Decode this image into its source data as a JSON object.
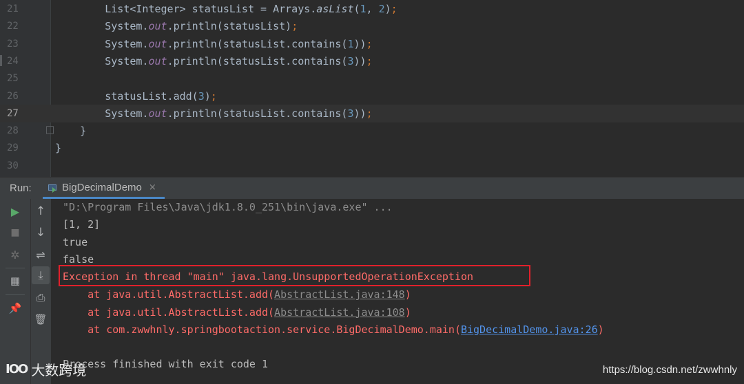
{
  "editor": {
    "lines": [
      {
        "num": "21",
        "indent": "        ",
        "tokens": [
          {
            "t": "List<Integer> statusList = Arrays."
          },
          {
            "t": "asList",
            "c": "k-m"
          },
          {
            "t": "("
          },
          {
            "t": "1",
            "c": "k-n"
          },
          {
            "t": ", "
          },
          {
            "t": "2",
            "c": "k-n"
          },
          {
            "t": ")"
          },
          {
            "t": ";",
            "c": "k-o"
          }
        ]
      },
      {
        "num": "22",
        "indent": "        ",
        "tokens": [
          {
            "t": "System."
          },
          {
            "t": "out",
            "c": "k-i"
          },
          {
            "t": ".println(statusList)"
          },
          {
            "t": ";",
            "c": "k-o"
          }
        ]
      },
      {
        "num": "23",
        "indent": "        ",
        "tokens": [
          {
            "t": "System."
          },
          {
            "t": "out",
            "c": "k-i"
          },
          {
            "t": ".println(statusList.contains("
          },
          {
            "t": "1",
            "c": "k-n"
          },
          {
            "t": "))"
          },
          {
            "t": ";",
            "c": "k-o"
          }
        ]
      },
      {
        "num": "24",
        "indent": "        ",
        "tokens": [
          {
            "t": "System."
          },
          {
            "t": "out",
            "c": "k-i"
          },
          {
            "t": ".println(statusList.contains("
          },
          {
            "t": "3",
            "c": "k-n"
          },
          {
            "t": "))"
          },
          {
            "t": ";",
            "c": "k-o"
          }
        ]
      },
      {
        "num": "25",
        "indent": "",
        "tokens": []
      },
      {
        "num": "26",
        "indent": "        ",
        "tokens": [
          {
            "t": "statusList.add("
          },
          {
            "t": "3",
            "c": "k-n"
          },
          {
            "t": ")"
          },
          {
            "t": ";",
            "c": "k-o"
          }
        ]
      },
      {
        "num": "27",
        "indent": "        ",
        "current": true,
        "tokens": [
          {
            "t": "System."
          },
          {
            "t": "out",
            "c": "k-i"
          },
          {
            "t": ".println(statusList.contains("
          },
          {
            "t": "3",
            "c": "k-n"
          },
          {
            "t": "))"
          },
          {
            "t": ";",
            "c": "k-o"
          }
        ]
      },
      {
        "num": "28",
        "indent": "    ",
        "tokens": [
          {
            "t": "}"
          }
        ]
      },
      {
        "num": "29",
        "indent": "",
        "tokens": [
          {
            "t": "}"
          }
        ]
      },
      {
        "num": "30",
        "indent": "",
        "tokens": []
      }
    ]
  },
  "run": {
    "label": "Run:",
    "tab_label": "BigDecimalDemo",
    "close_glyph": "×"
  },
  "toolbar_left": [
    {
      "name": "rerun-icon",
      "glyph": "▶",
      "color": "#59a869",
      "size": 16
    },
    {
      "name": "stop-icon",
      "glyph": "■",
      "color": "#6e6e6e",
      "size": 14
    },
    {
      "name": "debug-icon",
      "glyph": "✲",
      "color": "#6e6e6e",
      "size": 16
    },
    {
      "name": "layout-icon",
      "glyph": "▦",
      "color": "#afb1b3",
      "size": 15
    },
    {
      "name": "pin-icon",
      "glyph": "📌",
      "color": "#afb1b3",
      "size": 15
    }
  ],
  "toolbar_right": [
    {
      "name": "up-arrow-icon",
      "glyph": "↑",
      "color": "#afb1b3",
      "size": 17
    },
    {
      "name": "down-arrow-icon",
      "glyph": "↓",
      "color": "#afb1b3",
      "size": 17
    },
    {
      "name": "soft-wrap-icon",
      "glyph": "⇌",
      "color": "#afb1b3",
      "size": 16
    },
    {
      "name": "scroll-to-end-icon",
      "glyph": "⤓",
      "color": "#afb1b3",
      "size": 16
    },
    {
      "name": "print-icon",
      "glyph": "⎙",
      "color": "#afb1b3",
      "size": 16
    },
    {
      "name": "trash-icon",
      "glyph": "🗑",
      "color": "#afb1b3",
      "size": 15
    }
  ],
  "console": {
    "cmd": "\"D:\\Program Files\\Java\\jdk1.8.0_251\\bin\\java.exe\" ...",
    "out1": "[1, 2]",
    "out2": "true",
    "out3": "false",
    "exception": "Exception in thread \"main\" java.lang.UnsupportedOperationException",
    "trace": [
      {
        "prefix": "    at java.util.AbstractList.add(",
        "link": "AbstractList.java:148",
        "link_style": "gray",
        "suffix": ")"
      },
      {
        "prefix": "    at java.util.AbstractList.add(",
        "link": "AbstractList.java:108",
        "link_style": "gray",
        "suffix": ")"
      },
      {
        "prefix": "    at com.zwwhnly.springbootaction.service.BigDecimalDemo.main(",
        "link": "BigDecimalDemo.java:26",
        "link_style": "blue",
        "suffix": ")"
      }
    ],
    "finish": "Process finished with exit code 1"
  },
  "watermark": {
    "logo_mark": "IOO",
    "logo_text": "大数跨境",
    "url": "https://blog.csdn.net/zwwhnly"
  }
}
